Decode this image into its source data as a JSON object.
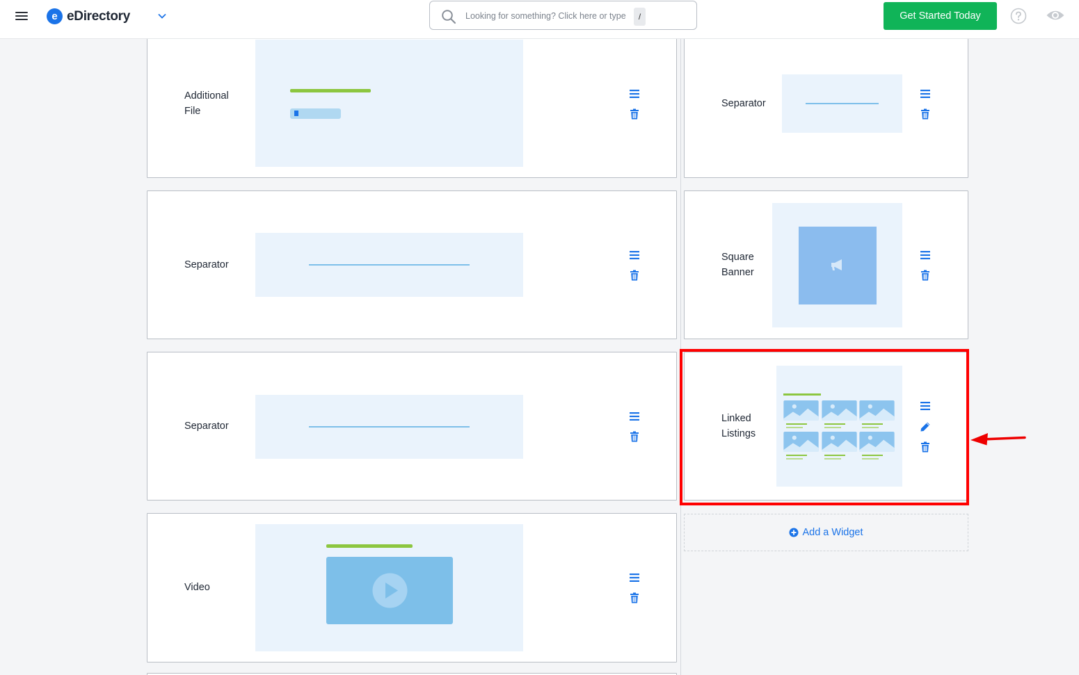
{
  "header": {
    "brand": "eDirectory",
    "search_placeholder": "Looking for something? Click here or type",
    "search_shortcut": "/",
    "cta_label": "Get Started Today"
  },
  "widgets_left": [
    {
      "label": "Additional File"
    },
    {
      "label": "Separator"
    },
    {
      "label": "Separator"
    },
    {
      "label": "Video"
    }
  ],
  "widgets_right": [
    {
      "label": "Separator"
    },
    {
      "label": "Square Banner"
    },
    {
      "label": "Linked Listings"
    }
  ],
  "add_widget_label": "Add a Widget",
  "colors": {
    "accent": "#1a73e8",
    "cta": "#10b458",
    "highlight": "#ff0000",
    "preview_bg": "#eaf3fc",
    "preview_green": "#8cc63f",
    "preview_blue": "#7dbfe9"
  }
}
